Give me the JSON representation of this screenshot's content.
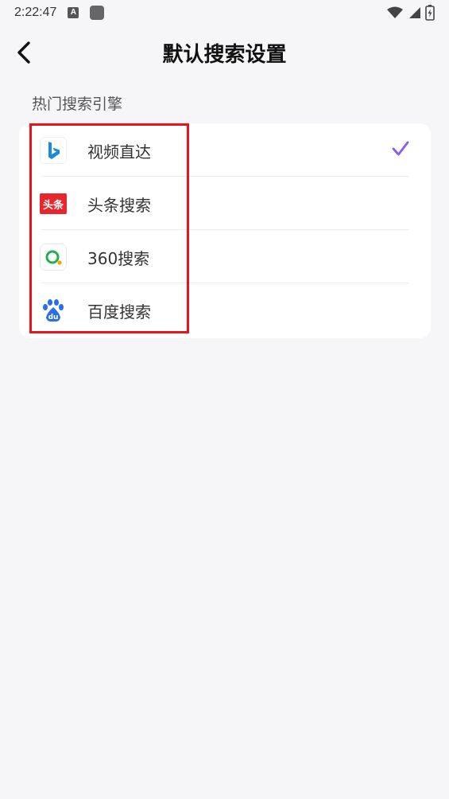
{
  "status": {
    "time": "2:22:47",
    "badge": "A"
  },
  "header": {
    "title": "默认搜索设置"
  },
  "section": {
    "title": "热门搜索引擎"
  },
  "engines": [
    {
      "label": "视频直达",
      "icon": "bing-logo-icon",
      "selected": true
    },
    {
      "label": "头条搜索",
      "icon": "toutiao-logo-icon",
      "logo_text": "头条",
      "selected": false
    },
    {
      "label": "360搜索",
      "icon": "360-logo-icon",
      "selected": false
    },
    {
      "label": "百度搜索",
      "icon": "baidu-logo-icon",
      "logo_text": "du",
      "selected": false
    }
  ],
  "colors": {
    "accent": "#8a5cf6",
    "highlight": "#e8141c",
    "toutiao": "#e8262e",
    "baidu": "#2b6fe6",
    "so360": "#22b14c"
  }
}
